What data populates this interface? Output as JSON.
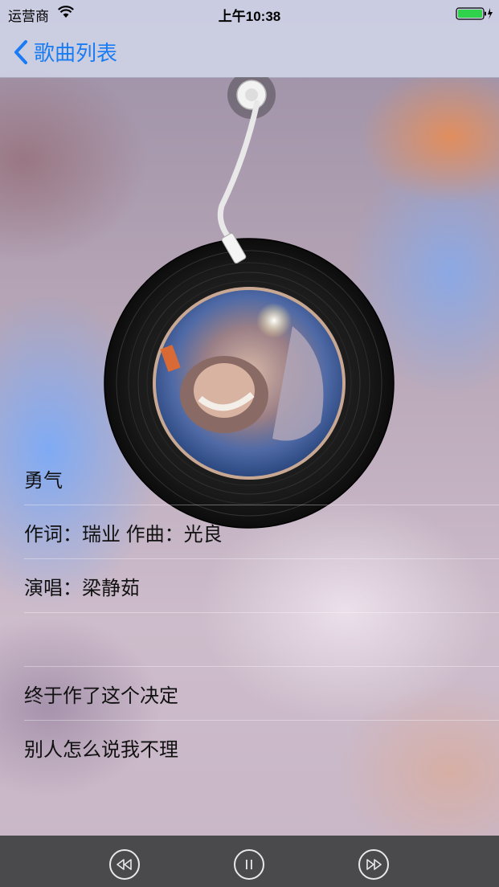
{
  "status_bar": {
    "carrier": "运营商",
    "time": "上午10:38",
    "wifi_icon": "wifi-icon",
    "battery_icon": "battery-charging-icon",
    "battery_level": 1.0
  },
  "nav": {
    "back_label": "歌曲列表",
    "back_icon": "chevron-left-icon",
    "accent_color": "#1a7cf2"
  },
  "player": {
    "album_art_icon": "album-cover-photo",
    "needle_icon": "tonearm-icon"
  },
  "lyrics": [
    "勇气",
    "作词：瑞业 作曲：光良",
    "演唱：梁静茹",
    "",
    "终于作了这个决定",
    "别人怎么说我不理"
  ],
  "controls": {
    "previous_icon": "rewind-icon",
    "pause_icon": "pause-icon",
    "next_icon": "fast-forward-icon"
  }
}
